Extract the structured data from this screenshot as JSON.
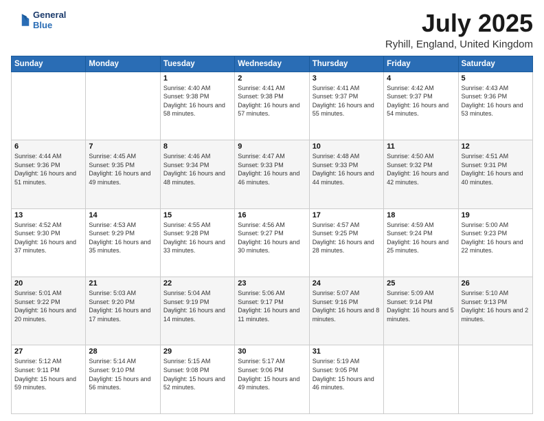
{
  "logo": {
    "line1": "General",
    "line2": "Blue"
  },
  "title": "July 2025",
  "subtitle": "Ryhill, England, United Kingdom",
  "days_of_week": [
    "Sunday",
    "Monday",
    "Tuesday",
    "Wednesday",
    "Thursday",
    "Friday",
    "Saturday"
  ],
  "weeks": [
    [
      {
        "day": "",
        "detail": ""
      },
      {
        "day": "",
        "detail": ""
      },
      {
        "day": "1",
        "detail": "Sunrise: 4:40 AM\nSunset: 9:38 PM\nDaylight: 16 hours and 58 minutes."
      },
      {
        "day": "2",
        "detail": "Sunrise: 4:41 AM\nSunset: 9:38 PM\nDaylight: 16 hours and 57 minutes."
      },
      {
        "day": "3",
        "detail": "Sunrise: 4:41 AM\nSunset: 9:37 PM\nDaylight: 16 hours and 55 minutes."
      },
      {
        "day": "4",
        "detail": "Sunrise: 4:42 AM\nSunset: 9:37 PM\nDaylight: 16 hours and 54 minutes."
      },
      {
        "day": "5",
        "detail": "Sunrise: 4:43 AM\nSunset: 9:36 PM\nDaylight: 16 hours and 53 minutes."
      }
    ],
    [
      {
        "day": "6",
        "detail": "Sunrise: 4:44 AM\nSunset: 9:36 PM\nDaylight: 16 hours and 51 minutes."
      },
      {
        "day": "7",
        "detail": "Sunrise: 4:45 AM\nSunset: 9:35 PM\nDaylight: 16 hours and 49 minutes."
      },
      {
        "day": "8",
        "detail": "Sunrise: 4:46 AM\nSunset: 9:34 PM\nDaylight: 16 hours and 48 minutes."
      },
      {
        "day": "9",
        "detail": "Sunrise: 4:47 AM\nSunset: 9:33 PM\nDaylight: 16 hours and 46 minutes."
      },
      {
        "day": "10",
        "detail": "Sunrise: 4:48 AM\nSunset: 9:33 PM\nDaylight: 16 hours and 44 minutes."
      },
      {
        "day": "11",
        "detail": "Sunrise: 4:50 AM\nSunset: 9:32 PM\nDaylight: 16 hours and 42 minutes."
      },
      {
        "day": "12",
        "detail": "Sunrise: 4:51 AM\nSunset: 9:31 PM\nDaylight: 16 hours and 40 minutes."
      }
    ],
    [
      {
        "day": "13",
        "detail": "Sunrise: 4:52 AM\nSunset: 9:30 PM\nDaylight: 16 hours and 37 minutes."
      },
      {
        "day": "14",
        "detail": "Sunrise: 4:53 AM\nSunset: 9:29 PM\nDaylight: 16 hours and 35 minutes."
      },
      {
        "day": "15",
        "detail": "Sunrise: 4:55 AM\nSunset: 9:28 PM\nDaylight: 16 hours and 33 minutes."
      },
      {
        "day": "16",
        "detail": "Sunrise: 4:56 AM\nSunset: 9:27 PM\nDaylight: 16 hours and 30 minutes."
      },
      {
        "day": "17",
        "detail": "Sunrise: 4:57 AM\nSunset: 9:25 PM\nDaylight: 16 hours and 28 minutes."
      },
      {
        "day": "18",
        "detail": "Sunrise: 4:59 AM\nSunset: 9:24 PM\nDaylight: 16 hours and 25 minutes."
      },
      {
        "day": "19",
        "detail": "Sunrise: 5:00 AM\nSunset: 9:23 PM\nDaylight: 16 hours and 22 minutes."
      }
    ],
    [
      {
        "day": "20",
        "detail": "Sunrise: 5:01 AM\nSunset: 9:22 PM\nDaylight: 16 hours and 20 minutes."
      },
      {
        "day": "21",
        "detail": "Sunrise: 5:03 AM\nSunset: 9:20 PM\nDaylight: 16 hours and 17 minutes."
      },
      {
        "day": "22",
        "detail": "Sunrise: 5:04 AM\nSunset: 9:19 PM\nDaylight: 16 hours and 14 minutes."
      },
      {
        "day": "23",
        "detail": "Sunrise: 5:06 AM\nSunset: 9:17 PM\nDaylight: 16 hours and 11 minutes."
      },
      {
        "day": "24",
        "detail": "Sunrise: 5:07 AM\nSunset: 9:16 PM\nDaylight: 16 hours and 8 minutes."
      },
      {
        "day": "25",
        "detail": "Sunrise: 5:09 AM\nSunset: 9:14 PM\nDaylight: 16 hours and 5 minutes."
      },
      {
        "day": "26",
        "detail": "Sunrise: 5:10 AM\nSunset: 9:13 PM\nDaylight: 16 hours and 2 minutes."
      }
    ],
    [
      {
        "day": "27",
        "detail": "Sunrise: 5:12 AM\nSunset: 9:11 PM\nDaylight: 15 hours and 59 minutes."
      },
      {
        "day": "28",
        "detail": "Sunrise: 5:14 AM\nSunset: 9:10 PM\nDaylight: 15 hours and 56 minutes."
      },
      {
        "day": "29",
        "detail": "Sunrise: 5:15 AM\nSunset: 9:08 PM\nDaylight: 15 hours and 52 minutes."
      },
      {
        "day": "30",
        "detail": "Sunrise: 5:17 AM\nSunset: 9:06 PM\nDaylight: 15 hours and 49 minutes."
      },
      {
        "day": "31",
        "detail": "Sunrise: 5:19 AM\nSunset: 9:05 PM\nDaylight: 15 hours and 46 minutes."
      },
      {
        "day": "",
        "detail": ""
      },
      {
        "day": "",
        "detail": ""
      }
    ]
  ]
}
